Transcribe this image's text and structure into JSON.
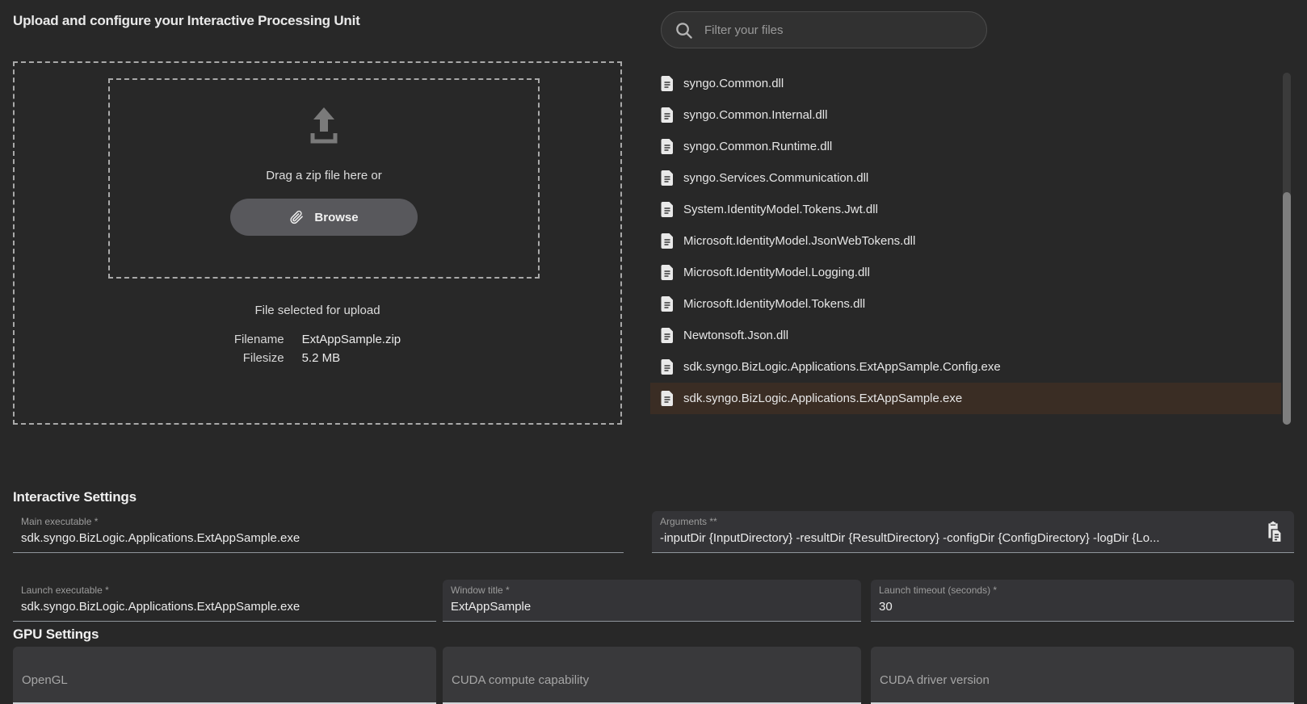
{
  "page": {
    "title": "Upload and configure your Interactive Processing Unit"
  },
  "upload": {
    "drop_text": "Drag a zip file here or",
    "browse_label": "Browse",
    "selected_heading": "File selected for upload",
    "filename_label": "Filename",
    "filename_value": "ExtAppSample.zip",
    "filesize_label": "Filesize",
    "filesize_value": "5.2 MB"
  },
  "file_browser": {
    "filter_placeholder": "Filter your files",
    "files": [
      {
        "name": "syngo.Common.dll",
        "selected": false
      },
      {
        "name": "syngo.Common.Internal.dll",
        "selected": false
      },
      {
        "name": "syngo.Common.Runtime.dll",
        "selected": false
      },
      {
        "name": "syngo.Services.Communication.dll",
        "selected": false
      },
      {
        "name": "System.IdentityModel.Tokens.Jwt.dll",
        "selected": false
      },
      {
        "name": "Microsoft.IdentityModel.JsonWebTokens.dll",
        "selected": false
      },
      {
        "name": "Microsoft.IdentityModel.Logging.dll",
        "selected": false
      },
      {
        "name": "Microsoft.IdentityModel.Tokens.dll",
        "selected": false
      },
      {
        "name": "Newtonsoft.Json.dll",
        "selected": false
      },
      {
        "name": "sdk.syngo.BizLogic.Applications.ExtAppSample.Config.exe",
        "selected": false
      },
      {
        "name": "sdk.syngo.BizLogic.Applications.ExtAppSample.exe",
        "selected": true
      }
    ]
  },
  "interactive_settings": {
    "heading": "Interactive Settings",
    "main_executable": {
      "label": "Main executable *",
      "value": "sdk.syngo.BizLogic.Applications.ExtAppSample.exe"
    },
    "arguments": {
      "label": "Arguments **",
      "value": "-inputDir {InputDirectory} -resultDir {ResultDirectory} -configDir {ConfigDirectory} -logDir {Lo..."
    },
    "launch_executable": {
      "label": "Launch executable *",
      "value": "sdk.syngo.BizLogic.Applications.ExtAppSample.exe"
    },
    "window_title": {
      "label": "Window title *",
      "value": "ExtAppSample"
    },
    "launch_timeout": {
      "label": "Launch timeout (seconds) *",
      "value": "30"
    }
  },
  "gpu_settings": {
    "heading": "GPU Settings",
    "opengl_label": "OpenGL",
    "cuda_compute_label": "CUDA compute capability",
    "cuda_driver_label": "CUDA driver version"
  },
  "colors": {
    "page_background": "#282828",
    "field_fill": "#343437",
    "selected_row": "#3a2d24",
    "underline": "#8f959b",
    "browse_button": "#58585c",
    "text_primary": "#ececec",
    "text_secondary": "#9c9c9c"
  }
}
